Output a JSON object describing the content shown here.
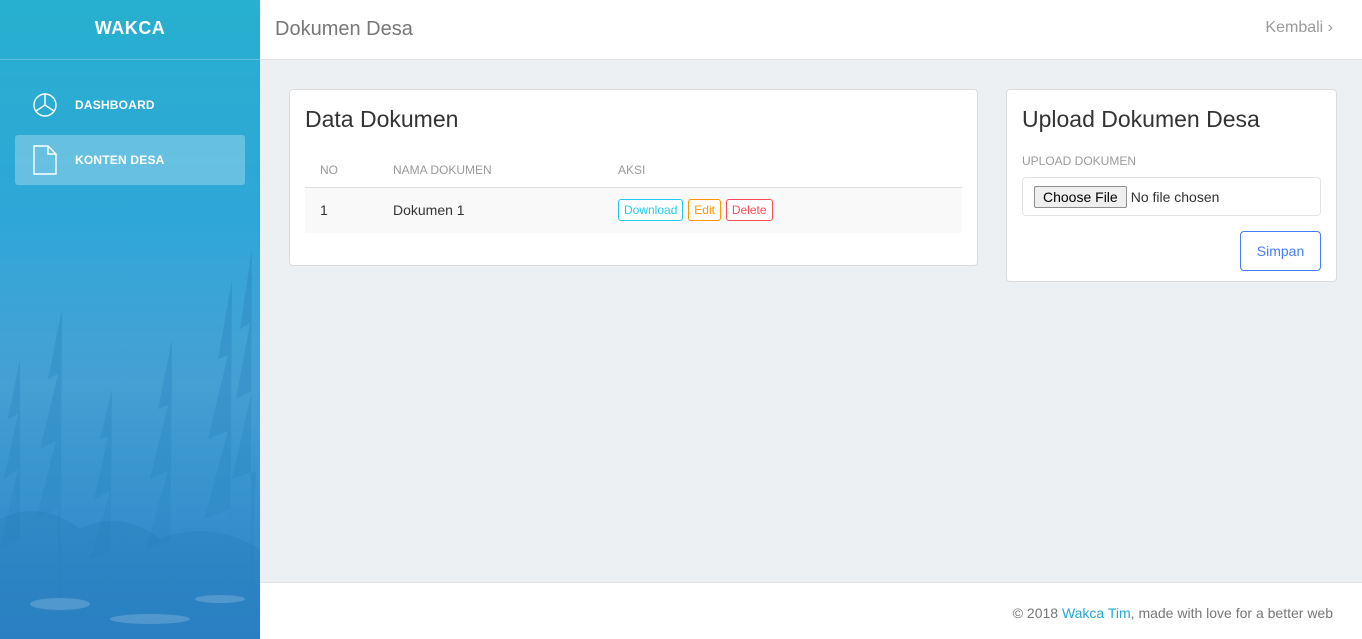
{
  "sidebar": {
    "brand": "WAKCA",
    "items": [
      {
        "label": "DASHBOARD",
        "icon": "pie-chart-icon",
        "active": false
      },
      {
        "label": "KONTEN DESA",
        "icon": "document-icon",
        "active": true
      }
    ]
  },
  "header": {
    "title": "Dokumen Desa",
    "back_link": "Kembali ›"
  },
  "data_card": {
    "title": "Data Dokumen",
    "columns": [
      "NO",
      "NAMA DOKUMEN",
      "AKSI"
    ],
    "rows": [
      {
        "no": "1",
        "name": "Dokumen 1",
        "actions": [
          "Download",
          "Edit",
          "Delete"
        ]
      }
    ]
  },
  "upload_card": {
    "title": "Upload Dokumen Desa",
    "field_label": "UPLOAD DOKUMEN",
    "file_button": "Choose File",
    "file_status": "No file chosen",
    "submit_label": "Simpan"
  },
  "footer": {
    "prefix": "© 2018 ",
    "link": "Wakca Tim",
    "suffix": ", made with love for a better web"
  },
  "colors": {
    "accent": "#447df7",
    "info": "#23ccef",
    "warning": "#ff9500",
    "danger": "#ff4a55",
    "footer_link": "#23a9d6"
  }
}
